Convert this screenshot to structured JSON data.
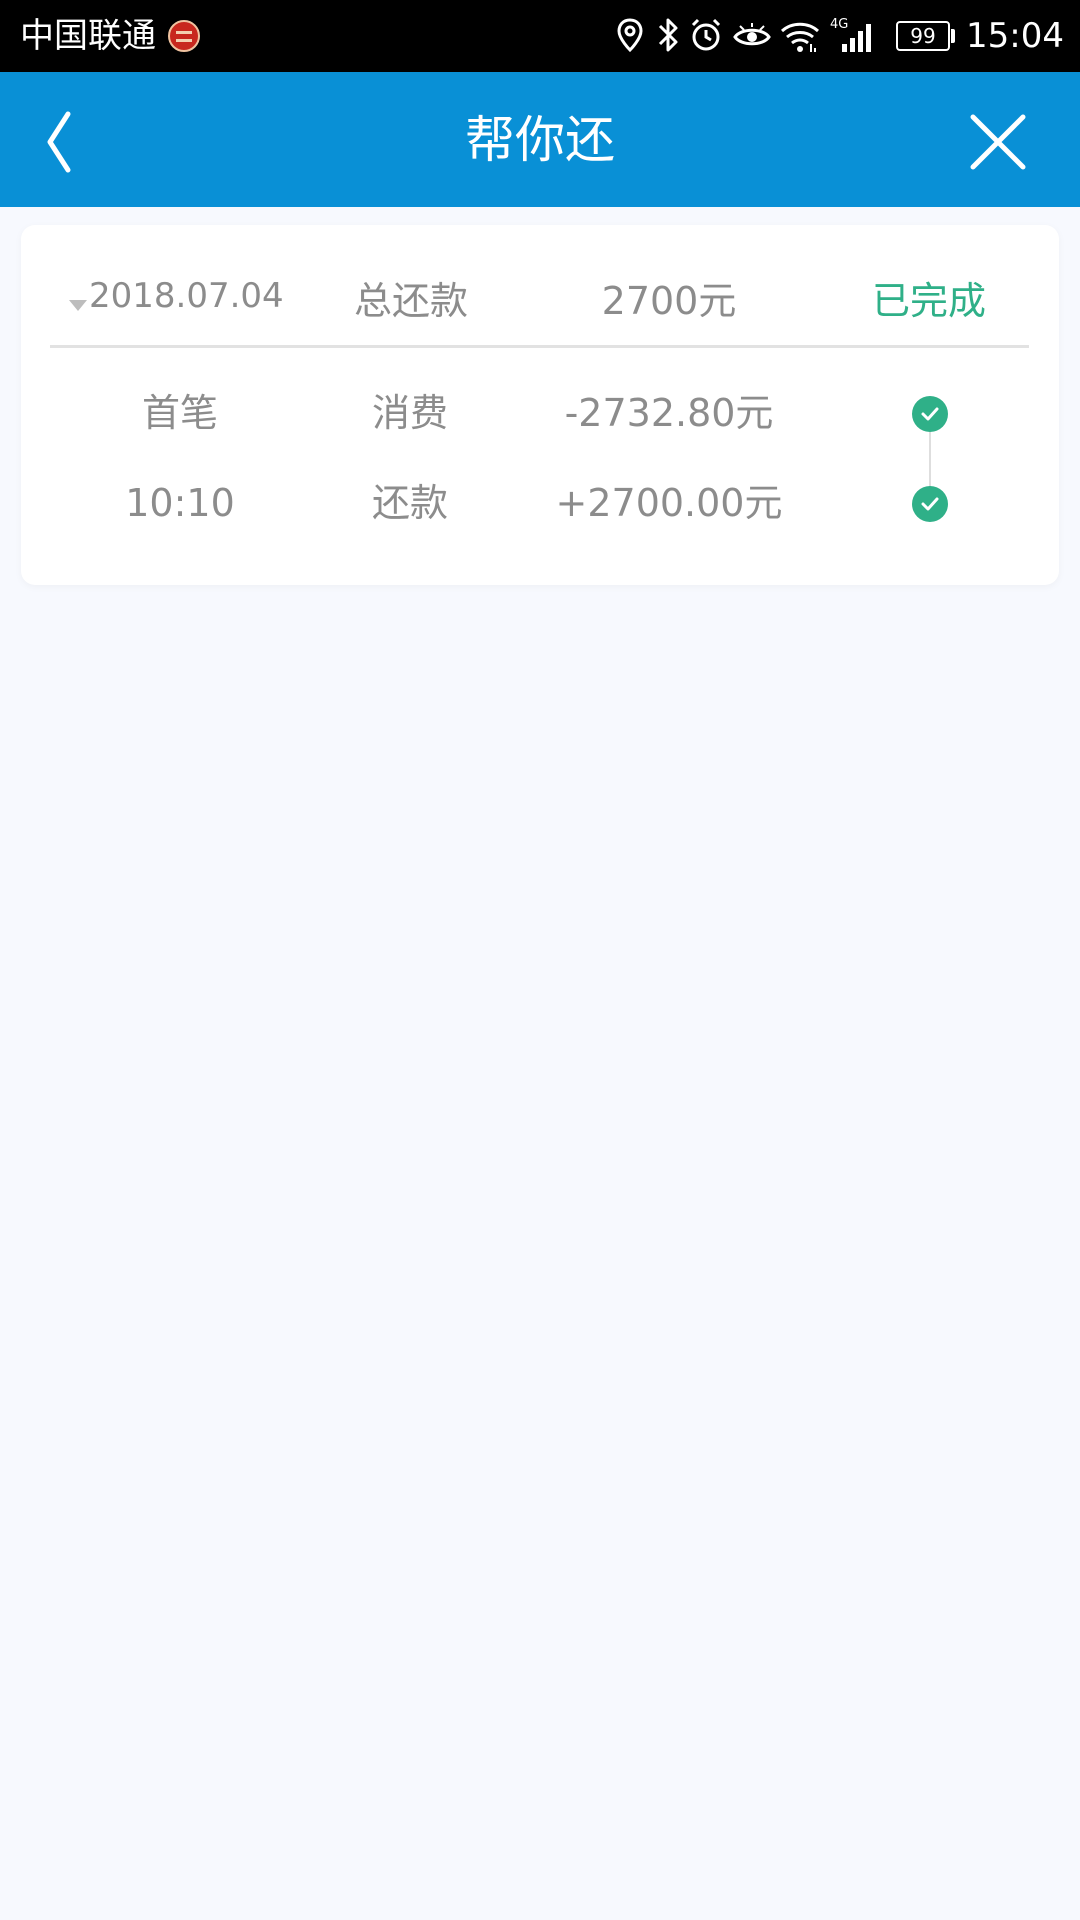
{
  "status_bar": {
    "carrier": "中国联通",
    "network_type": "4G",
    "battery": "99",
    "time": "15:04",
    "icons": [
      "location-icon",
      "bluetooth-icon",
      "alarm-icon",
      "eye-icon",
      "wifi-icon",
      "signal-icon",
      "battery-icon"
    ]
  },
  "header": {
    "title": "帮你还",
    "back_icon": "chevron-left-icon",
    "close_icon": "close-icon"
  },
  "plan": {
    "date": "2018.07.04",
    "type_label": "总还款",
    "amount": "2700元",
    "status": "已完成",
    "status_color": "#2fb088",
    "entries": [
      {
        "label": "首笔",
        "type": "消费",
        "amount": "-2732.80元",
        "status_icon": "check-circle-icon"
      },
      {
        "label": "10:10",
        "type": "还款",
        "amount": "+2700.00元",
        "status_icon": "check-circle-icon"
      }
    ]
  },
  "colors": {
    "header_bg": "#0990d6",
    "page_bg": "#f7f9fe",
    "success": "#2fb088"
  }
}
